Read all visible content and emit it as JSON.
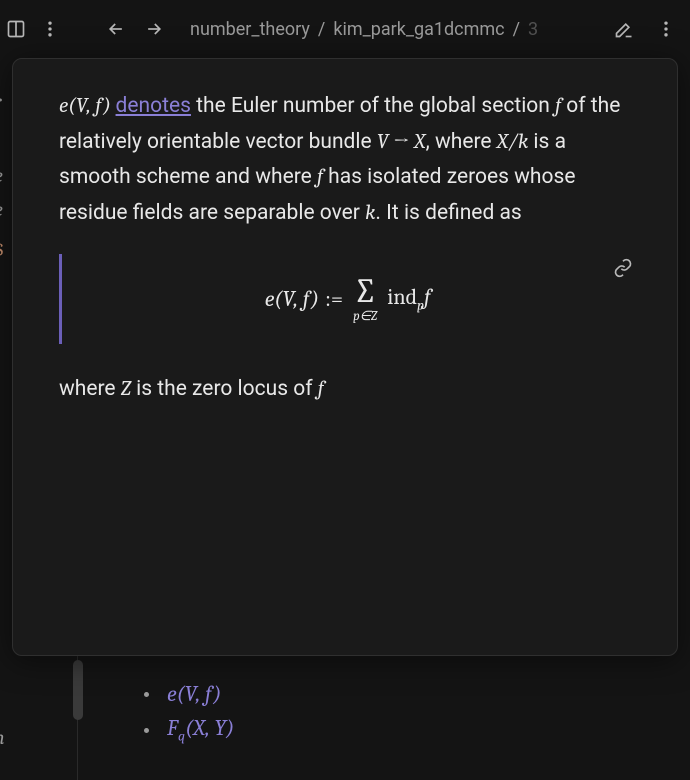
{
  "breadcrumbs": {
    "part1": "number_theory",
    "part2": "kim_park_ga1dcmmc",
    "part3": "3"
  },
  "gutter": {
    "g1": "r",
    "g2": "e",
    "g3": "e",
    "g4": "$",
    "g5": "-",
    "g6": "n"
  },
  "tooltip": {
    "intro_prefix": "e(V, f) ",
    "link_word": "denotes",
    "intro_rest_1": " the Euler number of the global section ",
    "f": "f",
    "intro_rest_2": " of the relatively orientable vector bundle ",
    "V": "V",
    "arrow": " → ",
    "X": "X",
    "intro_rest_3": ", where ",
    "Xk": "X/k",
    "intro_rest_4": " is a smooth scheme and where ",
    "f2": "f",
    "intro_rest_5": " has isolated zeroes whose residue fields are separable over ",
    "k": "k",
    "intro_rest_6": ". It is defined as",
    "equation": {
      "lhs": "e(V, f)",
      "def": ":=",
      "sum_sub": "p∈Z",
      "rhs_head": "ind",
      "rhs_sub": "p",
      "rhs_tail": "f"
    },
    "footer_1": "where ",
    "footer_Z": "Z",
    "footer_2": " is the zero locus of ",
    "footer_f": "f"
  },
  "bullets": {
    "item1_pre": "e(V, f)",
    "item2_pre": "F",
    "item2_sub": "q",
    "item2_post": "(X, Y)"
  }
}
